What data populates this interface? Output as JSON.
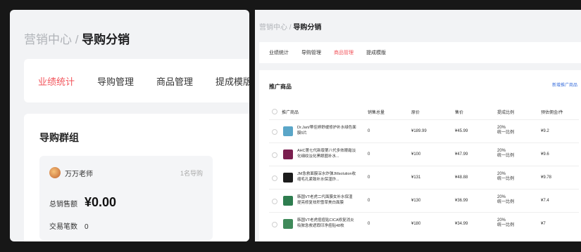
{
  "left": {
    "breadcrumb": {
      "parent": "营销中心",
      "separator": " / ",
      "current": "导购分销"
    },
    "tabs": [
      "业绩统计",
      "导购管理",
      "商品管理",
      "提成模版"
    ],
    "active_tab": 0,
    "card": {
      "title": "导购群组",
      "group": {
        "name": "万万老师",
        "member_count": "1名导购",
        "sales_label": "总销售额",
        "sales_value": "¥0.00",
        "tx_label": "交易笔数",
        "tx_value": "0"
      }
    }
  },
  "right": {
    "breadcrumb": {
      "parent": "营销中心",
      "separator": " / ",
      "current": "导购分销"
    },
    "tabs": [
      "业绩统计",
      "导购管理",
      "商品管理",
      "提成模版"
    ],
    "active_tab": 2,
    "card": {
      "title": "推广商品",
      "add_link": "新增推广商品",
      "columns": [
        "推广商品",
        "销售总量",
        "原价",
        "售价",
        "提成比例",
        "预估佣金/件"
      ],
      "rows": [
        {
          "name": "Dr.Jart/蒂佳婷舒缓修护补水绿色面膜5片",
          "sales": "0",
          "orig": "¥189.99",
          "price": "¥45.99",
          "rate": "20%",
          "rate_note": "统一比例",
          "commission": "¥9.2",
          "thumb": "#5aa6c8"
        },
        {
          "name": "AHC第七代新版第八代多效眼霜淡化细纹淡化黑眼圈补水...",
          "sales": "0",
          "orig": "¥100",
          "price": "¥47.99",
          "rate": "20%",
          "rate_note": "统一比例",
          "commission": "¥9.6",
          "thumb": "#7a1f4f"
        },
        {
          "name": "JM急救面膜深水炸弹JMsolution收缩毛孔紧致补水保湿炸...",
          "sales": "0",
          "orig": "¥131",
          "price": "¥48.88",
          "rate": "20%",
          "rate_note": "统一比例",
          "commission": "¥9.78",
          "thumb": "#1c1c1c"
        },
        {
          "name": "韩国VT老虎二代面膜女补水保湿提亮修复祛积雪草美白面膜",
          "sales": "0",
          "orig": "¥130",
          "price": "¥36.99",
          "rate": "20%",
          "rate_note": "统一比例",
          "commission": "¥7.4",
          "thumb": "#2e7d4f"
        },
        {
          "name": "韩国VT老虎痘痘贴CICA修复消炎吸脓急救遮瑕印净痘贴48枚",
          "sales": "0",
          "orig": "¥180",
          "price": "¥34.99",
          "rate": "20%",
          "rate_note": "统一比例",
          "commission": "¥7",
          "thumb": "#3f8a5a"
        }
      ]
    }
  }
}
